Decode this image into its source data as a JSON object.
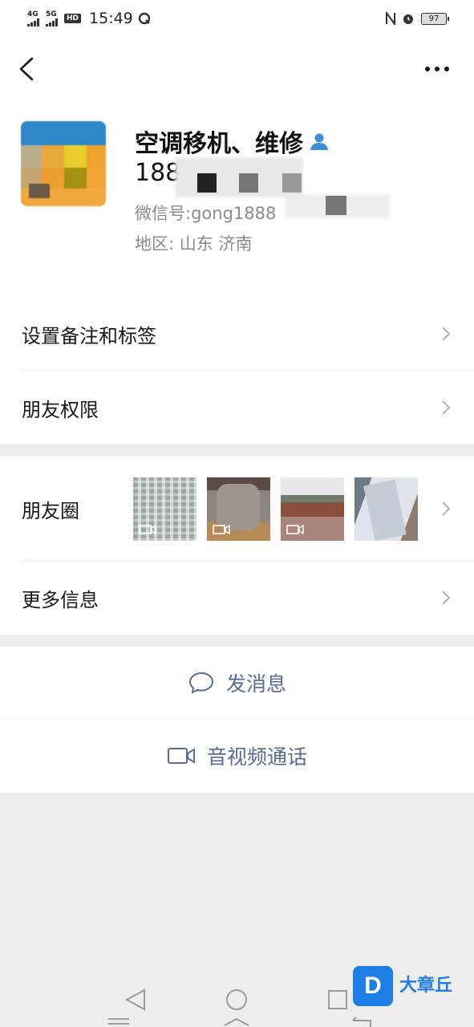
{
  "status_bar": {
    "network1": "4G",
    "network2": "5G",
    "hd": "HD",
    "time": "15:49",
    "battery": "97"
  },
  "profile": {
    "name": "空调移机、维修",
    "phone_visible": "188",
    "wechat_id_label": "微信号:",
    "wechat_id_visible": "gong1888",
    "region_label": "地区:",
    "region_value": "山东  济南"
  },
  "menu": {
    "remark_label": "设置备注和标签",
    "permissions_label": "朋友权限",
    "moments_label": "朋友圈",
    "more_info_label": "更多信息"
  },
  "actions": {
    "message_label": "发消息",
    "call_label": "音视频通话"
  },
  "watermark": {
    "logo_letter": "D",
    "name": "大章丘"
  },
  "colors": {
    "link": "#576b95",
    "background": "#ededed",
    "contact_icon": "#3d8fd6"
  }
}
